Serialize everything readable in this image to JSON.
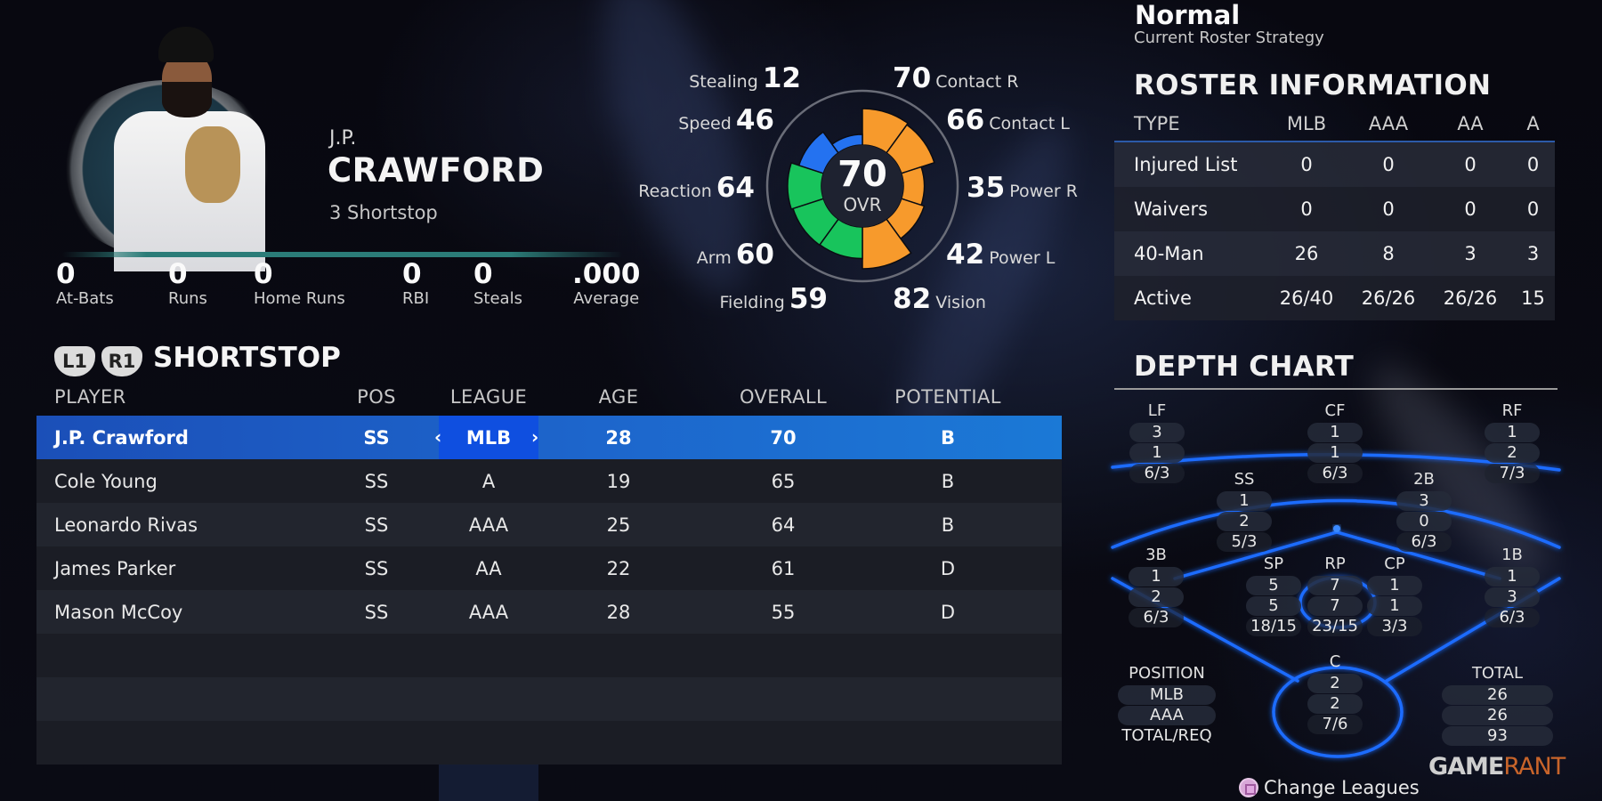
{
  "player": {
    "first_name": "J.P.",
    "last_name": "CRAWFORD",
    "subtitle": "3 Shortstop",
    "team_colors": {
      "primary": "#23485a",
      "accent": "#2b7c78"
    }
  },
  "season_stats": [
    {
      "value": "0",
      "label": "At-Bats"
    },
    {
      "value": "0",
      "label": "Runs"
    },
    {
      "value": "0",
      "label": "Home Runs"
    },
    {
      "value": "0",
      "label": "RBI"
    },
    {
      "value": "0",
      "label": "Steals"
    },
    {
      "value": ".000",
      "label": "Average"
    }
  ],
  "attributes": {
    "overall": "70",
    "overall_label": "OVR",
    "left": [
      {
        "label": "Stealing",
        "value": "12",
        "group": "baserunning"
      },
      {
        "label": "Speed",
        "value": "46",
        "group": "baserunning"
      },
      {
        "label": "Reaction",
        "value": "64",
        "group": "defense"
      },
      {
        "label": "Arm",
        "value": "60",
        "group": "defense"
      },
      {
        "label": "Fielding",
        "value": "59",
        "group": "defense"
      }
    ],
    "right": [
      {
        "label": "Contact R",
        "value": "70",
        "group": "hitting"
      },
      {
        "label": "Contact L",
        "value": "66",
        "group": "hitting"
      },
      {
        "label": "Power R",
        "value": "35",
        "group": "hitting"
      },
      {
        "label": "Power L",
        "value": "42",
        "group": "hitting"
      },
      {
        "label": "Vision",
        "value": "82",
        "group": "hitting"
      }
    ],
    "group_colors": {
      "hitting": "#f79a2c",
      "defense": "#18c45c",
      "baserunning": "#2472f0"
    }
  },
  "strategy": {
    "value": "Normal",
    "label": "Current Roster Strategy"
  },
  "roster_info": {
    "title": "ROSTER INFORMATION",
    "columns": [
      "TYPE",
      "MLB",
      "AAA",
      "AA",
      "A"
    ],
    "rows": [
      [
        "Injured List",
        "0",
        "0",
        "0",
        "0"
      ],
      [
        "Waivers",
        "0",
        "0",
        "0",
        "0"
      ],
      [
        "40-Man",
        "26",
        "8",
        "3",
        "3"
      ],
      [
        "Active",
        "26/40",
        "26/26",
        "26/26",
        "15"
      ]
    ]
  },
  "position_table": {
    "button_left": "L1",
    "button_right": "R1",
    "title": "SHORTSTOP",
    "columns": [
      "PLAYER",
      "POS",
      "LEAGUE",
      "AGE",
      "OVERALL",
      "POTENTIAL"
    ],
    "rows": [
      {
        "player": "J.P. Crawford",
        "pos": "SS",
        "league": "MLB",
        "age": "28",
        "overall": "70",
        "potential": "B",
        "selected": true
      },
      {
        "player": "Cole Young",
        "pos": "SS",
        "league": "A",
        "age": "19",
        "overall": "65",
        "potential": "B"
      },
      {
        "player": "Leonardo Rivas",
        "pos": "SS",
        "league": "AAA",
        "age": "25",
        "overall": "64",
        "potential": "B"
      },
      {
        "player": "James Parker",
        "pos": "SS",
        "league": "AA",
        "age": "22",
        "overall": "61",
        "potential": "D"
      },
      {
        "player": "Mason McCoy",
        "pos": "SS",
        "league": "AAA",
        "age": "28",
        "overall": "55",
        "potential": "D"
      }
    ],
    "empty_rows": 3,
    "selected_color": "#1d66cc"
  },
  "depth_chart": {
    "title": "DEPTH CHART",
    "positions": {
      "LF": [
        "3",
        "1",
        "6/3"
      ],
      "CF": [
        "1",
        "1",
        "6/3"
      ],
      "RF": [
        "1",
        "2",
        "7/3"
      ],
      "SS": [
        "1",
        "2",
        "5/3"
      ],
      "2B": [
        "3",
        "0",
        "6/3"
      ],
      "3B": [
        "1",
        "2",
        "6/3"
      ],
      "1B": [
        "1",
        "3",
        "6/3"
      ],
      "SP": [
        "5",
        "5",
        "18/15"
      ],
      "RP": [
        "7",
        "7",
        "23/15"
      ],
      "CP": [
        "1",
        "1",
        "3/3"
      ],
      "C": [
        "2",
        "2",
        "7/6"
      ]
    },
    "legend_header": "POSITION",
    "legend_rows": [
      "MLB",
      "AAA",
      "TOTAL/REQ"
    ],
    "total_header": "TOTAL",
    "totals": [
      "26",
      "26",
      "93"
    ],
    "line_color": "#1f6cff"
  },
  "footer": {
    "change_leagues_label": "Change Leagues",
    "button_icon": "square-button-icon"
  },
  "watermark": {
    "part1": "GAME",
    "part2": "RANT"
  }
}
